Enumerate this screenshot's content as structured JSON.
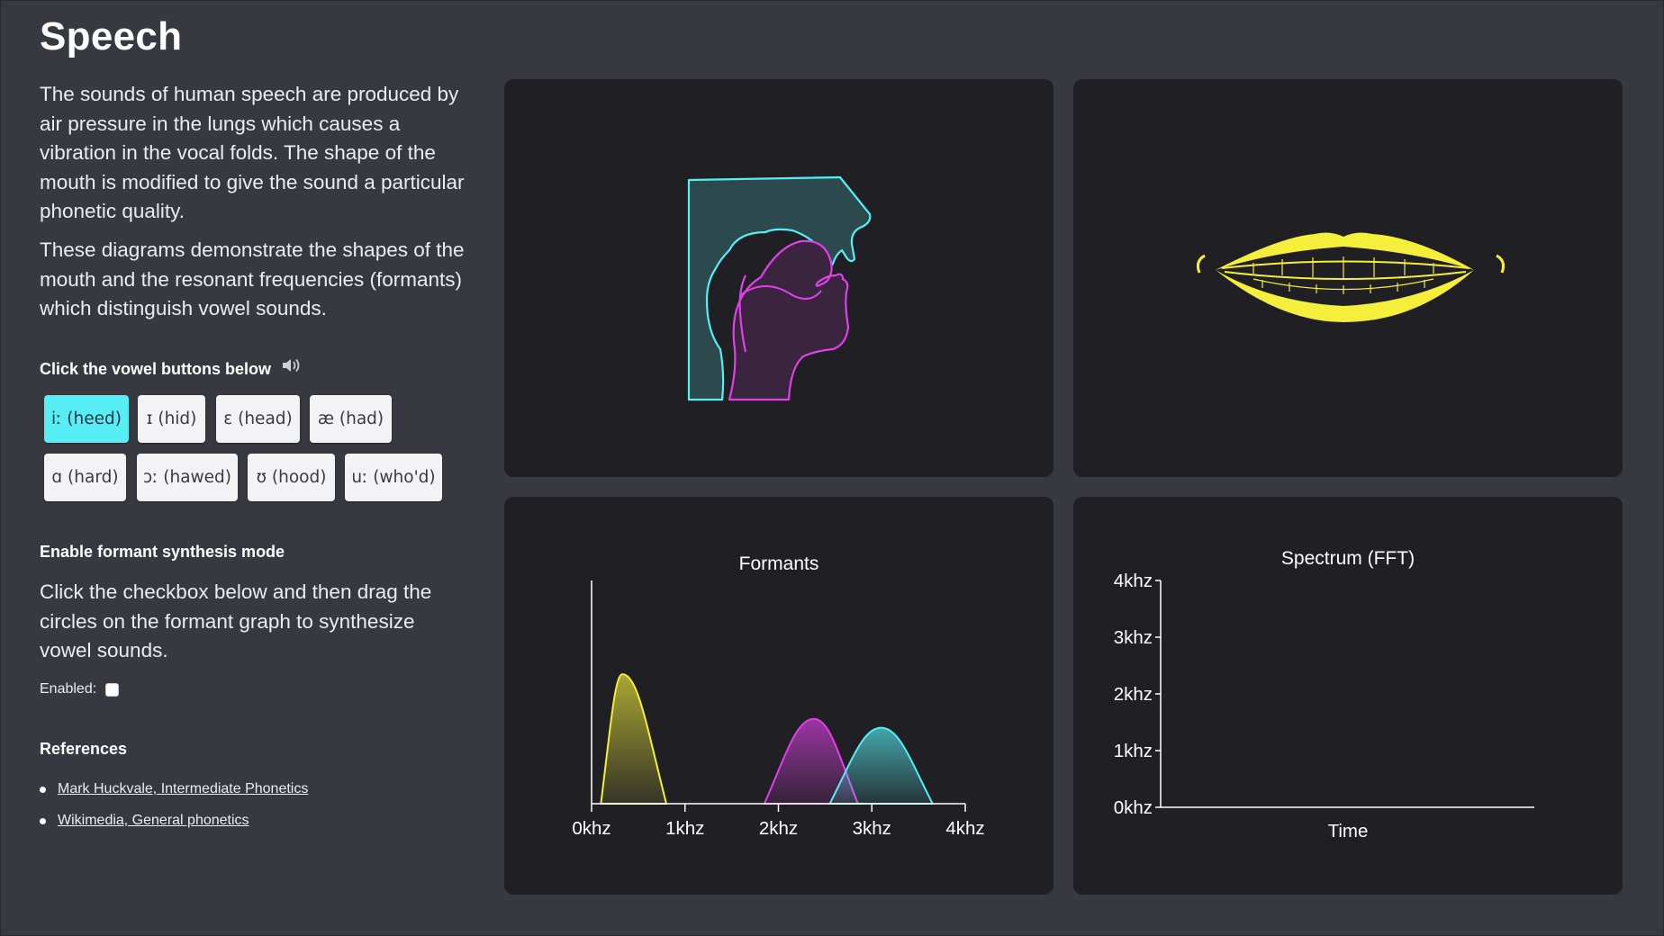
{
  "page": {
    "title": "Speech",
    "intro_1": "The sounds of human speech are produced by air pressure in the lungs which causes a vibration in the vocal folds. The shape of the mouth is modified to give the sound a particular phonetic quality.",
    "intro_2": "These diagrams demonstrate the shapes of the mouth and the resonant frequencies (formants) which distinguish vowel sounds."
  },
  "vowels": {
    "heading": "Click the vowel buttons below",
    "speaker_icon": "speaker-icon",
    "buttons": [
      {
        "label": "iː (heed)",
        "active": true
      },
      {
        "label": "ɪ (hid)",
        "active": false
      },
      {
        "label": "ɛ (head)",
        "active": false
      },
      {
        "label": "æ (had)",
        "active": false
      },
      {
        "label": "ɑ (hard)",
        "active": false
      },
      {
        "label": "ɔː (hawed)",
        "active": false
      },
      {
        "label": "ʊ (hood)",
        "active": false
      },
      {
        "label": "uː (who'd)",
        "active": false
      }
    ]
  },
  "synthesis": {
    "heading": "Enable formant synthesis mode",
    "description": "Click the checkbox below and then drag the circles on the formant graph to synthesize vowel sounds.",
    "enabled_label": "Enabled:",
    "enabled": false
  },
  "references": {
    "heading": "References",
    "links": [
      "Mark Huckvale, Intermediate Phonetics",
      "Wikimedia, General phonetics"
    ]
  },
  "colors": {
    "accent": "#56eef4",
    "magenta": "#e040e8",
    "yellow": "#f5ee3a",
    "panel": "#202024",
    "background": "#383840"
  },
  "chart_data": [
    {
      "type": "area",
      "title": "Formants",
      "xlabel": "",
      "ylabel": "",
      "x_ticks": [
        "0khz",
        "1khz",
        "2khz",
        "3khz",
        "4khz"
      ],
      "xlim": [
        0,
        4
      ],
      "x_unit": "khz",
      "series": [
        {
          "color": "#f5ee3a",
          "center_khz": 0.33,
          "left_khz": 0.1,
          "right_khz": 0.8,
          "height": 0.58
        },
        {
          "color": "#e040e8",
          "center_khz": 2.38,
          "left_khz": 1.85,
          "right_khz": 2.85,
          "height": 0.38
        },
        {
          "color": "#56eef4",
          "center_khz": 3.1,
          "left_khz": 2.55,
          "right_khz": 3.65,
          "height": 0.34
        }
      ]
    },
    {
      "type": "line",
      "title": "Spectrum (FFT)",
      "xlabel": "Time",
      "ylabel": "",
      "y_ticks": [
        "0khz",
        "1khz",
        "2khz",
        "3khz",
        "4khz"
      ],
      "ylim": [
        0,
        4
      ],
      "series": []
    }
  ]
}
